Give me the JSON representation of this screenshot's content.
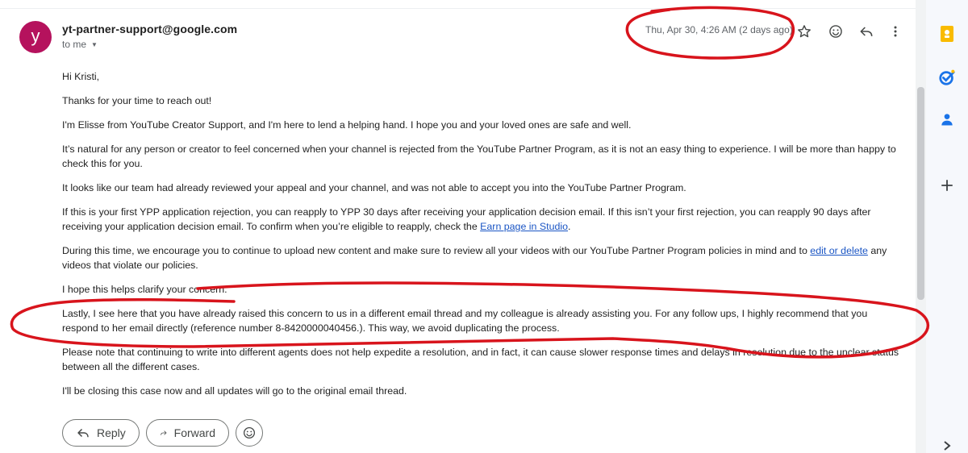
{
  "sender": {
    "avatar_letter": "y",
    "email": "yt-partner-support@google.com",
    "to_label": "to me"
  },
  "header": {
    "date": "Thu, Apr 30, 4:26 AM (2 days ago)"
  },
  "icons": {
    "star": "star-icon",
    "emoji": "emoji-icon",
    "reply": "reply-icon",
    "more": "more-vert-icon",
    "side": [
      "keep-icon",
      "tasks-icon",
      "contacts-icon",
      "add-icon",
      "expand-icon"
    ]
  },
  "body": {
    "greeting": "Hi Kristi,",
    "p1": "Thanks for your time to reach out!",
    "p2": "I'm Elisse from YouTube Creator Support, and I'm here to lend a helping hand. I hope you and your loved ones are safe and well.",
    "p3": "It’s natural for any person or creator to feel concerned when your channel is rejected from the YouTube Partner Program, as it is not an easy thing to experience. I will be more than happy to check this for you.",
    "p4": "It looks like our team had already reviewed your appeal and your channel, and was not able to accept you into the YouTube Partner Program.",
    "p5_before": "If this is your first YPP application rejection, you can reapply to YPP 30 days after receiving your application decision email. If this isn’t your first rejection, you can reapply 90 days after receiving your application decision email. To confirm when you’re eligible to reapply, check the ",
    "p5_link": "Earn page in Studio",
    "p5_after": ".",
    "p6_before": "During this time, we encourage you to continue to upload new content and make sure to review all your videos with our YouTube Partner Program policies in mind and to ",
    "p6_link": "edit or delete",
    "p6_after": " any videos that violate our policies.",
    "p7": "I hope this helps clarify your concern.",
    "p8": "Lastly, I see here that you have already raised this concern to us in a different email thread and my colleague is already assisting you. For any follow ups, I highly recommend that you respond to her email directly (reference number 8-8420000040456.). This way, we avoid duplicating the process.",
    "p9": "Please note that continuing to write into different agents does not help expedite a resolution, and in fact, it can cause slower response times and delays in resolution due to the unclear status between all the different cases.",
    "p10": "I'll be closing this case now and all updates will go to the original email thread."
  },
  "actions": {
    "reply_label": "Reply",
    "forward_label": "Forward"
  },
  "colors": {
    "avatar": "#b5125d",
    "link": "#1a55c4",
    "annotation": "#d8141c"
  }
}
